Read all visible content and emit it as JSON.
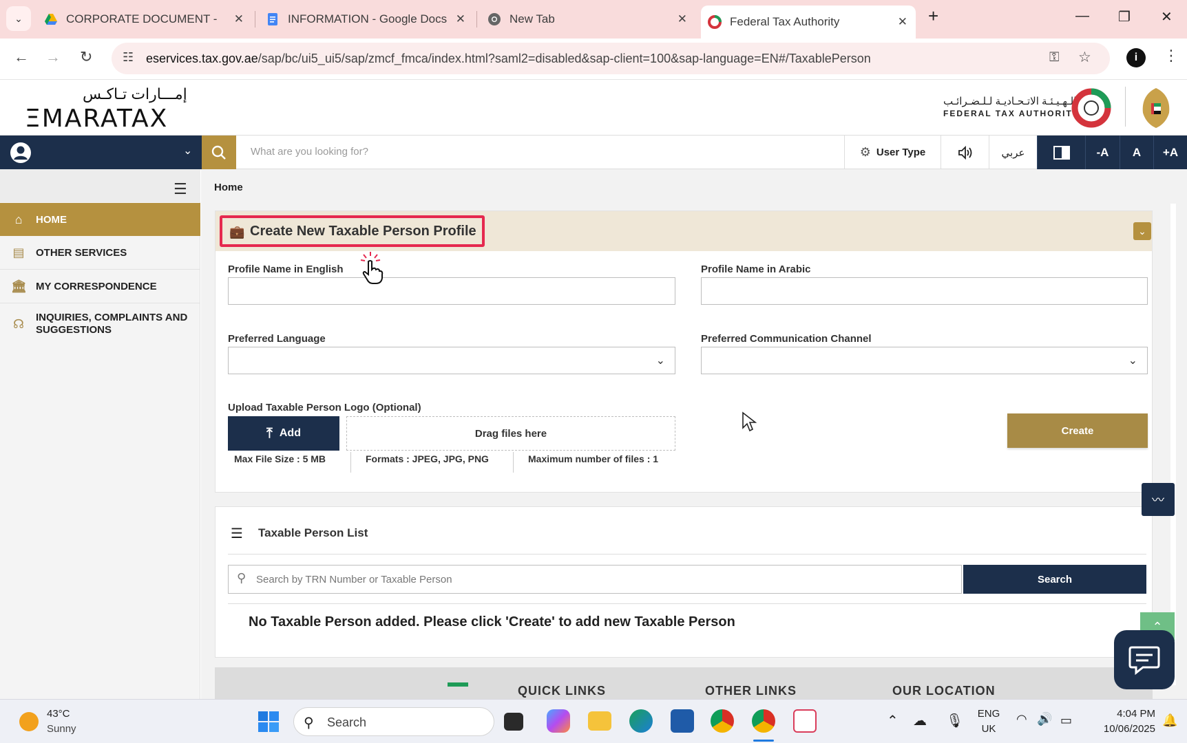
{
  "browser": {
    "tabs": [
      {
        "title": "CORPORATE DOCUMENT - Acc"
      },
      {
        "title": "INFORMATION - Google Docs"
      },
      {
        "title": "New Tab"
      },
      {
        "title": "Federal Tax Authority"
      }
    ],
    "url_host": "eservices.tax.gov.ae",
    "url_path": "/sap/bc/ui5_ui5/sap/zmcf_fmca/index.html?saml2=disabled&sap-client=100&sap-language=EN#/TaxablePerson"
  },
  "header": {
    "logo_arabic": "إمـــارات تـاكـس",
    "logo_english": "ΞMARATAX",
    "authority_arabic": "الـهـيـئـة الاتـحـاديـة لـلـضـرائـب",
    "authority_english": "FEDERAL TAX AUTHORITY"
  },
  "toolbar": {
    "search_placeholder": "What are you looking for?",
    "user_type": "User Type",
    "arabic": "عربي",
    "font_decrease": "-A",
    "font_normal": "A",
    "font_increase": "+A"
  },
  "sidebar": {
    "items": [
      {
        "label": "HOME",
        "icon": "home-icon",
        "active": true
      },
      {
        "label": "OTHER SERVICES",
        "icon": "clipboard-icon"
      },
      {
        "label": "MY CORRESPONDENCE",
        "icon": "bank-icon"
      },
      {
        "label": "INQUIRIES, COMPLAINTS AND SUGGESTIONS",
        "icon": "headset-icon"
      }
    ]
  },
  "main": {
    "breadcrumb": "Home",
    "panel_title": "Create New Taxable Person Profile",
    "form": {
      "profile_name_en_label": "Profile Name in English",
      "profile_name_ar_label": "Profile Name in Arabic",
      "preferred_language_label": "Preferred Language",
      "preferred_channel_label": "Preferred Communication Channel",
      "upload_label": "Upload Taxable Person Logo (Optional)",
      "add_button": "Add",
      "drag_text": "Drag files here",
      "max_size": "Max File Size : 5 MB",
      "formats": "Formats : JPEG, JPG, PNG",
      "max_files": "Maximum number of files : 1",
      "create_button": "Create"
    },
    "list": {
      "title": "Taxable Person List",
      "search_placeholder": "Search by TRN Number or Taxable Person",
      "search_button": "Search",
      "empty_message": "No Taxable Person added. Please click 'Create' to add new Taxable Person"
    },
    "footer_links": [
      "QUICK LINKS",
      "OTHER LINKS",
      "OUR LOCATION"
    ]
  },
  "taskbar": {
    "temperature": "43°C",
    "weather": "Sunny",
    "search_label": "Search",
    "language_line1": "ENG",
    "language_line2": "UK",
    "time": "4:04 PM",
    "date": "10/06/2025"
  },
  "colors": {
    "navy": "#1c2f4b",
    "gold": "#b5913f",
    "highlight": "#e5294f"
  }
}
